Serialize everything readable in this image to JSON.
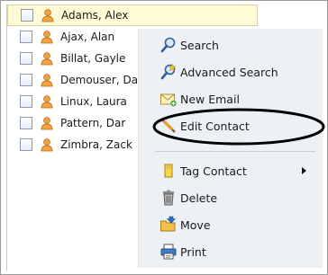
{
  "contacts": [
    {
      "name": "Adams, Alex",
      "selected": true
    },
    {
      "name": "Ajax, Alan",
      "selected": false
    },
    {
      "name": "Billat, Gayle",
      "selected": false
    },
    {
      "name": "Demouser, Da",
      "selected": false
    },
    {
      "name": "Linux, Laura",
      "selected": false
    },
    {
      "name": "Pattern, Dar",
      "selected": false
    },
    {
      "name": "Zimbra, Zack",
      "selected": false
    }
  ],
  "context_menu": {
    "search": {
      "label": "Search",
      "icon": "magnifier-icon"
    },
    "advanced_search": {
      "label": "Advanced Search",
      "icon": "advanced-search-icon"
    },
    "new_email": {
      "label": "New Email",
      "icon": "new-email-icon"
    },
    "edit_contact": {
      "label": "Edit Contact",
      "icon": "pencil-icon"
    },
    "tag_contact": {
      "label": "Tag Contact",
      "icon": "tag-icon"
    },
    "delete": {
      "label": "Delete",
      "icon": "trash-icon"
    },
    "move": {
      "label": "Move",
      "icon": "move-folder-icon"
    },
    "print": {
      "label": "Print",
      "icon": "printer-icon"
    }
  },
  "colors": {
    "selected_row": "#fffbd6",
    "menu_background": "#edf1f6",
    "person_icon": "#e0943a",
    "highlight_ellipse": "#000000"
  }
}
